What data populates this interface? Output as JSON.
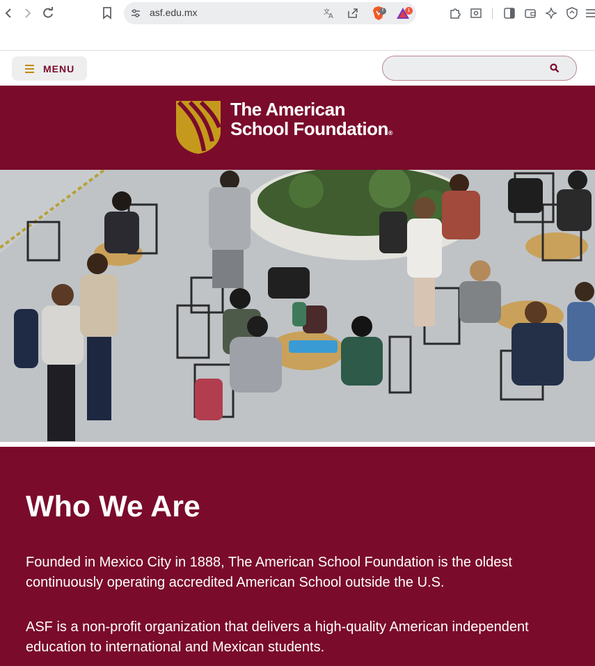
{
  "browser": {
    "url": "asf.edu.mx",
    "icons": [
      "back-icon",
      "forward-icon",
      "reload-icon",
      "bookmark-icon",
      "site-settings-icon",
      "translate-icon",
      "share-icon",
      "brave-shields-icon",
      "brave-rewards-icon",
      "extensions-icon",
      "screenshot-icon",
      "sidebar-icon",
      "wallet-icon",
      "leo-ai-icon",
      "vpn-icon",
      "browser-menu-icon"
    ],
    "shields_badge": "f",
    "rewards_badge": "1"
  },
  "header": {
    "menu_label": "MENU",
    "search_placeholder": ""
  },
  "logo": {
    "line1": "The American",
    "line2": "School Foundation",
    "reg_mark": "®"
  },
  "hero": {
    "image_subject": "students-in-school-atrium-photo"
  },
  "who_we_are": {
    "heading": "Who We Are",
    "paragraph1": "Founded in Mexico City in 1888, The American School Foundation is the oldest continuously operating accredited American School outside the U.S.",
    "paragraph2": "ASF is a non-profit organization that delivers a high-quality American independent education to international and Mexican students."
  },
  "colors": {
    "maroon": "#7a0b2b",
    "gold": "#c59a1c",
    "white": "#ffffff"
  }
}
